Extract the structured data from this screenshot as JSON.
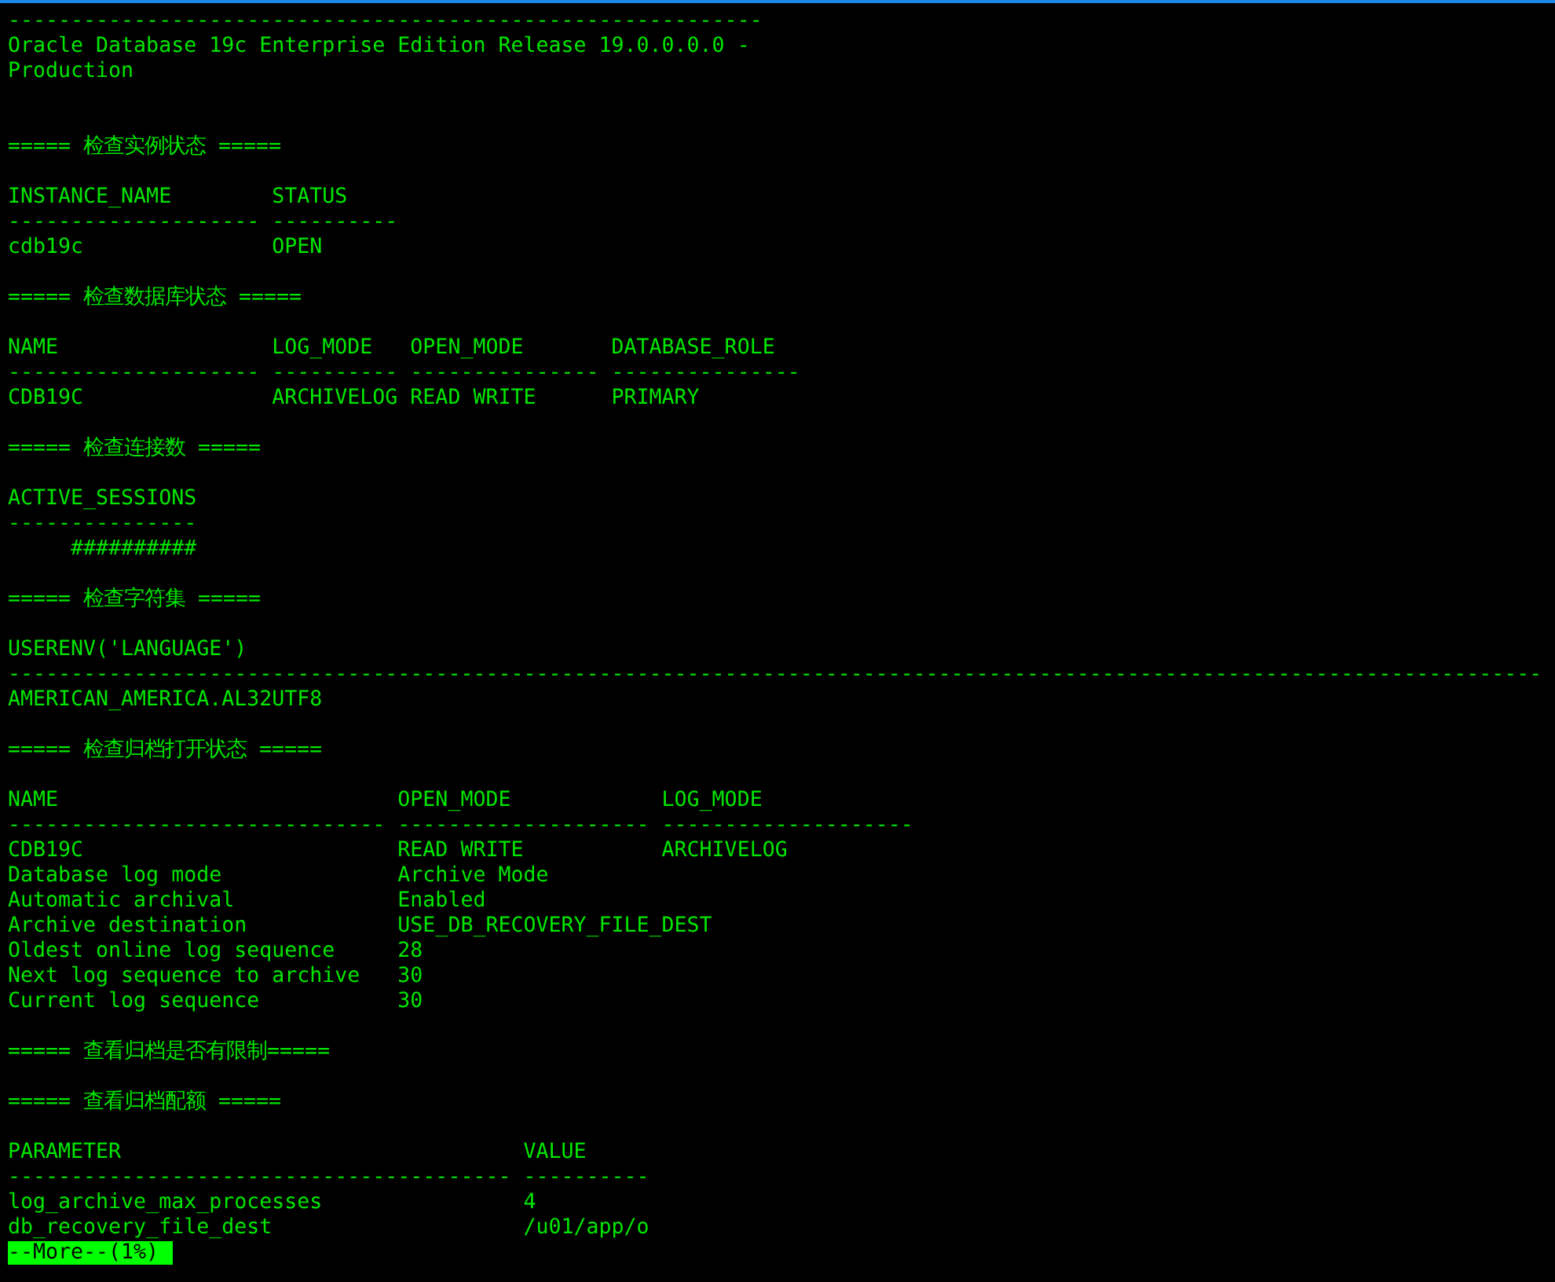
{
  "terminal": {
    "lines": [
      {
        "kind": "text",
        "text": "------------------------------------------------------------"
      },
      {
        "kind": "text",
        "text": "Oracle Database 19c Enterprise Edition Release 19.0.0.0.0 -"
      },
      {
        "kind": "text",
        "text": "Production"
      },
      {
        "kind": "blank"
      },
      {
        "kind": "blank"
      },
      {
        "kind": "text",
        "text": "===== 检查实例状态 ====="
      },
      {
        "kind": "blank"
      },
      {
        "kind": "text",
        "text": "INSTANCE_NAME        STATUS"
      },
      {
        "kind": "text",
        "text": "-------------------- ----------"
      },
      {
        "kind": "text",
        "text": "cdb19c               OPEN"
      },
      {
        "kind": "blank"
      },
      {
        "kind": "text",
        "text": "===== 检查数据库状态 ====="
      },
      {
        "kind": "blank"
      },
      {
        "kind": "text",
        "text": "NAME                 LOG_MODE   OPEN_MODE       DATABASE_ROLE"
      },
      {
        "kind": "text",
        "text": "-------------------- ---------- --------------- ---------------"
      },
      {
        "kind": "text",
        "text": "CDB19C               ARCHIVELOG READ WRITE      PRIMARY"
      },
      {
        "kind": "blank"
      },
      {
        "kind": "text",
        "text": "===== 检查连接数 ====="
      },
      {
        "kind": "blank"
      },
      {
        "kind": "text",
        "text": "ACTIVE_SESSIONS"
      },
      {
        "kind": "text",
        "text": "---------------"
      },
      {
        "kind": "text",
        "text": "     ##########"
      },
      {
        "kind": "blank"
      },
      {
        "kind": "text",
        "text": "===== 检查字符集 ====="
      },
      {
        "kind": "blank"
      },
      {
        "kind": "text",
        "text": "USERENV('LANGUAGE')"
      },
      {
        "kind": "text",
        "text": "--------------------------------------------------------------------------------------------------------------------------"
      },
      {
        "kind": "text",
        "text": "AMERICAN_AMERICA.AL32UTF8"
      },
      {
        "kind": "blank"
      },
      {
        "kind": "text",
        "text": "===== 检查归档打开状态 ====="
      },
      {
        "kind": "blank"
      },
      {
        "kind": "text",
        "text": "NAME                           OPEN_MODE            LOG_MODE"
      },
      {
        "kind": "text",
        "text": "------------------------------ -------------------- --------------------"
      },
      {
        "kind": "text",
        "text": "CDB19C                         READ WRITE           ARCHIVELOG"
      },
      {
        "kind": "text",
        "text": "Database log mode              Archive Mode"
      },
      {
        "kind": "text",
        "text": "Automatic archival             Enabled"
      },
      {
        "kind": "text",
        "text": "Archive destination            USE_DB_RECOVERY_FILE_DEST"
      },
      {
        "kind": "text",
        "text": "Oldest online log sequence     28"
      },
      {
        "kind": "text",
        "text": "Next log sequence to archive   30"
      },
      {
        "kind": "text",
        "text": "Current log sequence           30"
      },
      {
        "kind": "blank"
      },
      {
        "kind": "text",
        "text": "===== 查看归档是否有限制====="
      },
      {
        "kind": "blank"
      },
      {
        "kind": "text",
        "text": "===== 查看归档配额 ====="
      },
      {
        "kind": "blank"
      },
      {
        "kind": "text",
        "text": "PARAMETER                                VALUE"
      },
      {
        "kind": "text",
        "text": "---------------------------------------- ----------"
      },
      {
        "kind": "text",
        "text": "log_archive_max_processes                4"
      },
      {
        "kind": "text",
        "text": "db_recovery_file_dest                    /u01/app/o"
      }
    ],
    "pager": {
      "text": "--More--(1%)"
    }
  }
}
